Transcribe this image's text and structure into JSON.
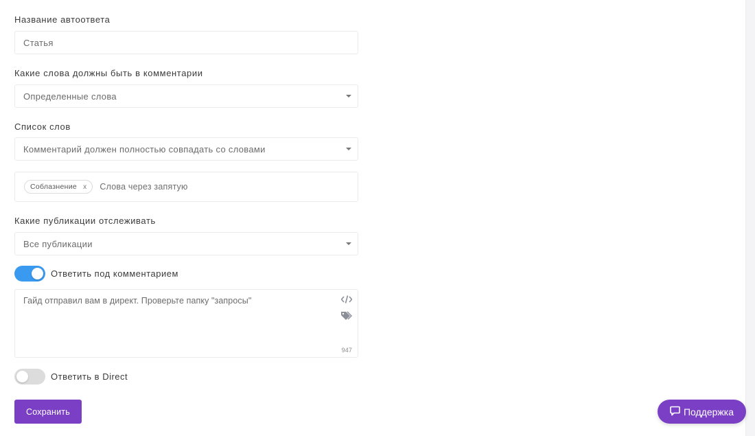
{
  "form": {
    "name_label": "Название автоответа",
    "name_value": "Статья",
    "words_rule_label": "Какие слова должны быть в комментарии",
    "words_rule_value": "Определенные слова",
    "word_list_label": "Список слов",
    "word_match_value": "Комментарий должен полностью совпадать со словами",
    "tags": [
      "Соблазнение"
    ],
    "tag_remove": "x",
    "tags_placeholder": "Слова через запятую",
    "publications_label": "Какие публикации отслеживать",
    "publications_value": "Все публикации",
    "reply_comment_toggle": {
      "label": "Ответить под комментарием",
      "on": true
    },
    "reply_text": "Гайд отправил вам в директ. Проверьте папку \"запросы\"",
    "char_counter": "947",
    "reply_direct_toggle": {
      "label": "Ответить в Direct",
      "on": false
    },
    "save_label": "Сохранить"
  },
  "support": {
    "label": "Поддержка",
    "icon": "chat-icon"
  },
  "colors": {
    "accent": "#7a3fc5",
    "toggle_on": "#3a9af0",
    "toggle_off": "#dcdcdc"
  }
}
